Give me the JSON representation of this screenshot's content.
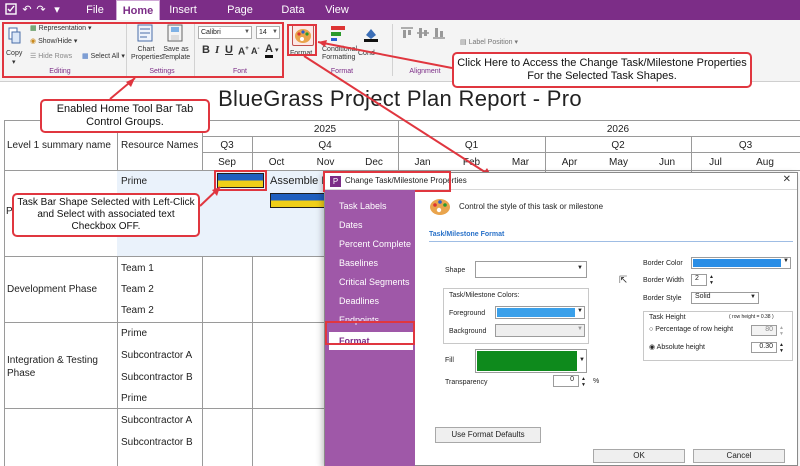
{
  "ribbon": {
    "tabs": [
      "File",
      "Home",
      "Insert",
      "Page Layout",
      "Data",
      "View"
    ],
    "active_tab": "Home",
    "editing": {
      "copy_label": "Copy",
      "representation_label": "Representation",
      "showhide_label": "Show/Hide",
      "hide_rows_label": "Hide Rows",
      "select_all_label": "Select All",
      "group_label": "Editing"
    },
    "settings": {
      "chart_properties_label": "Chart Properties",
      "save_template_label": "Save as Template",
      "group_label": "Settings"
    },
    "font": {
      "font_name": "Calibri",
      "font_size": "14",
      "group_label": "Font"
    },
    "format": {
      "format_label": "Format",
      "conditional_label": "Conditional Formatting",
      "cond_label": "Cond",
      "group_label": "Format"
    },
    "alignment": {
      "label_position": "Label Position",
      "group_label": "Alignment"
    },
    "colors": {
      "brand": "#7c2d87",
      "callout_border": "#e0363f"
    }
  },
  "callouts": {
    "home_toolbar": "Enabled Home Tool Bar Tab Control Groups.",
    "format_access": "Click Here to Access the Change Task/Milestone Properties For the Selected Task Shapes.",
    "task_bar": "Task Bar Shape Selected with Left-Click and Select with associated text Checkbox OFF."
  },
  "report": {
    "title": "BlueGrass Project Plan Report - Pro",
    "years": [
      "2025",
      "2026"
    ],
    "quarters": [
      "Q3",
      "Q4",
      "Q1",
      "Q2",
      "Q3"
    ],
    "months": [
      "Sep",
      "Oct",
      "Nov",
      "Dec",
      "Jan",
      "Feb",
      "Mar",
      "Apr",
      "May",
      "Jun",
      "Jul",
      "Aug"
    ],
    "col_summary": "Level 1 summary name",
    "col_resource": "Resource Names",
    "rows": [
      {
        "summary": "",
        "resources": [
          "Prime"
        ]
      },
      {
        "summary": "Development Phase",
        "resources": [
          "Team 1",
          "Team 2",
          "Team 2"
        ]
      },
      {
        "summary": "Integration & Testing Phase",
        "resources": [
          "Prime",
          "Subcontractor A",
          "Subcontractor B",
          "Prime"
        ]
      },
      {
        "summary": "",
        "resources": [
          "Subcontractor A",
          "Subcontractor B"
        ]
      }
    ],
    "task_label": "Assemble R",
    "bar_colors": {
      "top": "#1f5fbf",
      "bottom": "#f0cf18"
    }
  },
  "dialog": {
    "title": "Change Task/Milestone Properties",
    "close_glyph": "✕",
    "nav": [
      "Task Labels",
      "Dates",
      "Percent Complete",
      "Baselines",
      "Critical Segments",
      "Deadlines",
      "Endpoints",
      "Format"
    ],
    "selected_nav": "Format",
    "header": "Control the style of this task or milestone",
    "section": "Task/Milestone Format",
    "shape_label": "Shape",
    "colors_group": "Task/Milestone Colors:",
    "foreground_label": "Foreground",
    "background_label": "Background",
    "fill_label": "Fill",
    "transparency_label": "Transparency",
    "transparency_value": "0",
    "transparency_unit": "%",
    "border_color_label": "Border Color",
    "border_width_label": "Border Width",
    "border_width_value": "2",
    "border_style_label": "Border Style",
    "border_style_value": "Solid",
    "task_height_label": "Task Height",
    "row_height_note": "( row height = 0.38 )",
    "pct_row_label": "Percentage of row height",
    "pct_row_value": "80",
    "abs_height_label": "Absolute height",
    "abs_height_value": "0.30",
    "defaults_button": "Use Format Defaults",
    "ok_button": "OK",
    "cancel_button": "Cancel",
    "colors": {
      "sidebar": "#9f58a8",
      "section_header": "#2a72c9",
      "foreground_swatch": "#3aa0ea",
      "fill_swatch": "#0e8a1c",
      "border_swatch": "#2a8ee6"
    }
  }
}
